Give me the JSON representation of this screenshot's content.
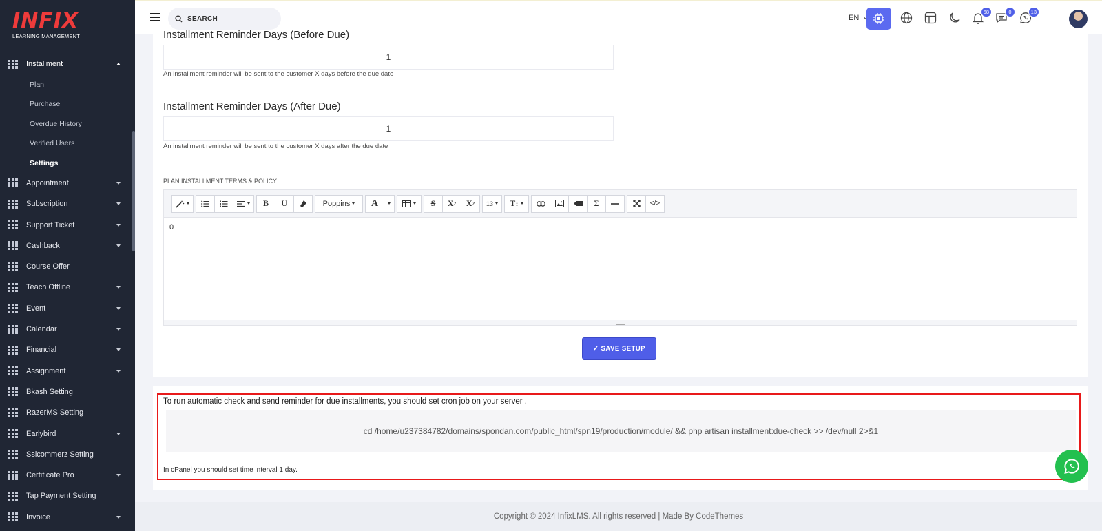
{
  "logo": {
    "brand": "INFIX",
    "tagline": "LEARNING MANAGEMENT"
  },
  "sidebar": {
    "open_section": "Installment",
    "sub_items": [
      "Plan",
      "Purchase",
      "Overdue History",
      "Verified Users",
      "Settings"
    ],
    "active_sub": "Settings",
    "items": [
      {
        "label": "Appointment",
        "caret": true
      },
      {
        "label": "Subscription",
        "caret": true
      },
      {
        "label": "Support Ticket",
        "caret": true
      },
      {
        "label": "Cashback",
        "caret": true
      },
      {
        "label": "Course Offer",
        "caret": false
      },
      {
        "label": "Teach Offline",
        "caret": true
      },
      {
        "label": "Event",
        "caret": true
      },
      {
        "label": "Calendar",
        "caret": true
      },
      {
        "label": "Financial",
        "caret": true
      },
      {
        "label": "Assignment",
        "caret": true
      },
      {
        "label": "Bkash Setting",
        "caret": false
      },
      {
        "label": "RazerMS Setting",
        "caret": false
      },
      {
        "label": "Earlybird",
        "caret": true
      },
      {
        "label": "Sslcommerz Setting",
        "caret": false
      },
      {
        "label": "Certificate Pro",
        "caret": true
      },
      {
        "label": "Tap Payment Setting",
        "caret": false
      },
      {
        "label": "Invoice",
        "caret": true
      }
    ]
  },
  "topbar": {
    "search_placeholder": "SEARCH",
    "language": "EN",
    "notifications_count": "68",
    "messages_count": "0",
    "whatsapp_count": "13"
  },
  "form": {
    "before_due_label": "Installment Reminder Days (Before Due)",
    "before_due_value": "1",
    "before_due_help": "An installment reminder will be sent to the customer X days before the due date",
    "after_due_label": "Installment Reminder Days (After Due)",
    "after_due_value": "1",
    "after_due_help": "An installment reminder will be sent to the customer X days after the due date",
    "terms_label": "PLAN INSTALLMENT TERMS & POLICY",
    "editor_font": "Poppins",
    "editor_font_size": "13",
    "editor_content": "0",
    "save_label": "✓ SAVE SETUP"
  },
  "cron": {
    "title": "To run automatic check and send reminder for due installments, you should set cron job on your server .",
    "command": "cd /home/u237384782/domains/spondan.com/public_html/spn19/production/module/ && php artisan installment:due-check >> /dev/null 2>&1",
    "note": "In cPanel you should set time interval 1 day."
  },
  "footer": {
    "text": "Copyright © 2024 InfixLMS. All rights reserved | Made By CodeThemes"
  },
  "colors": {
    "sidebar_bg": "#202634",
    "accent": "#4f5ee8",
    "brand_red": "#ee3b3b",
    "highlight_red": "#e8191a",
    "whatsapp_green": "#23c04f"
  }
}
